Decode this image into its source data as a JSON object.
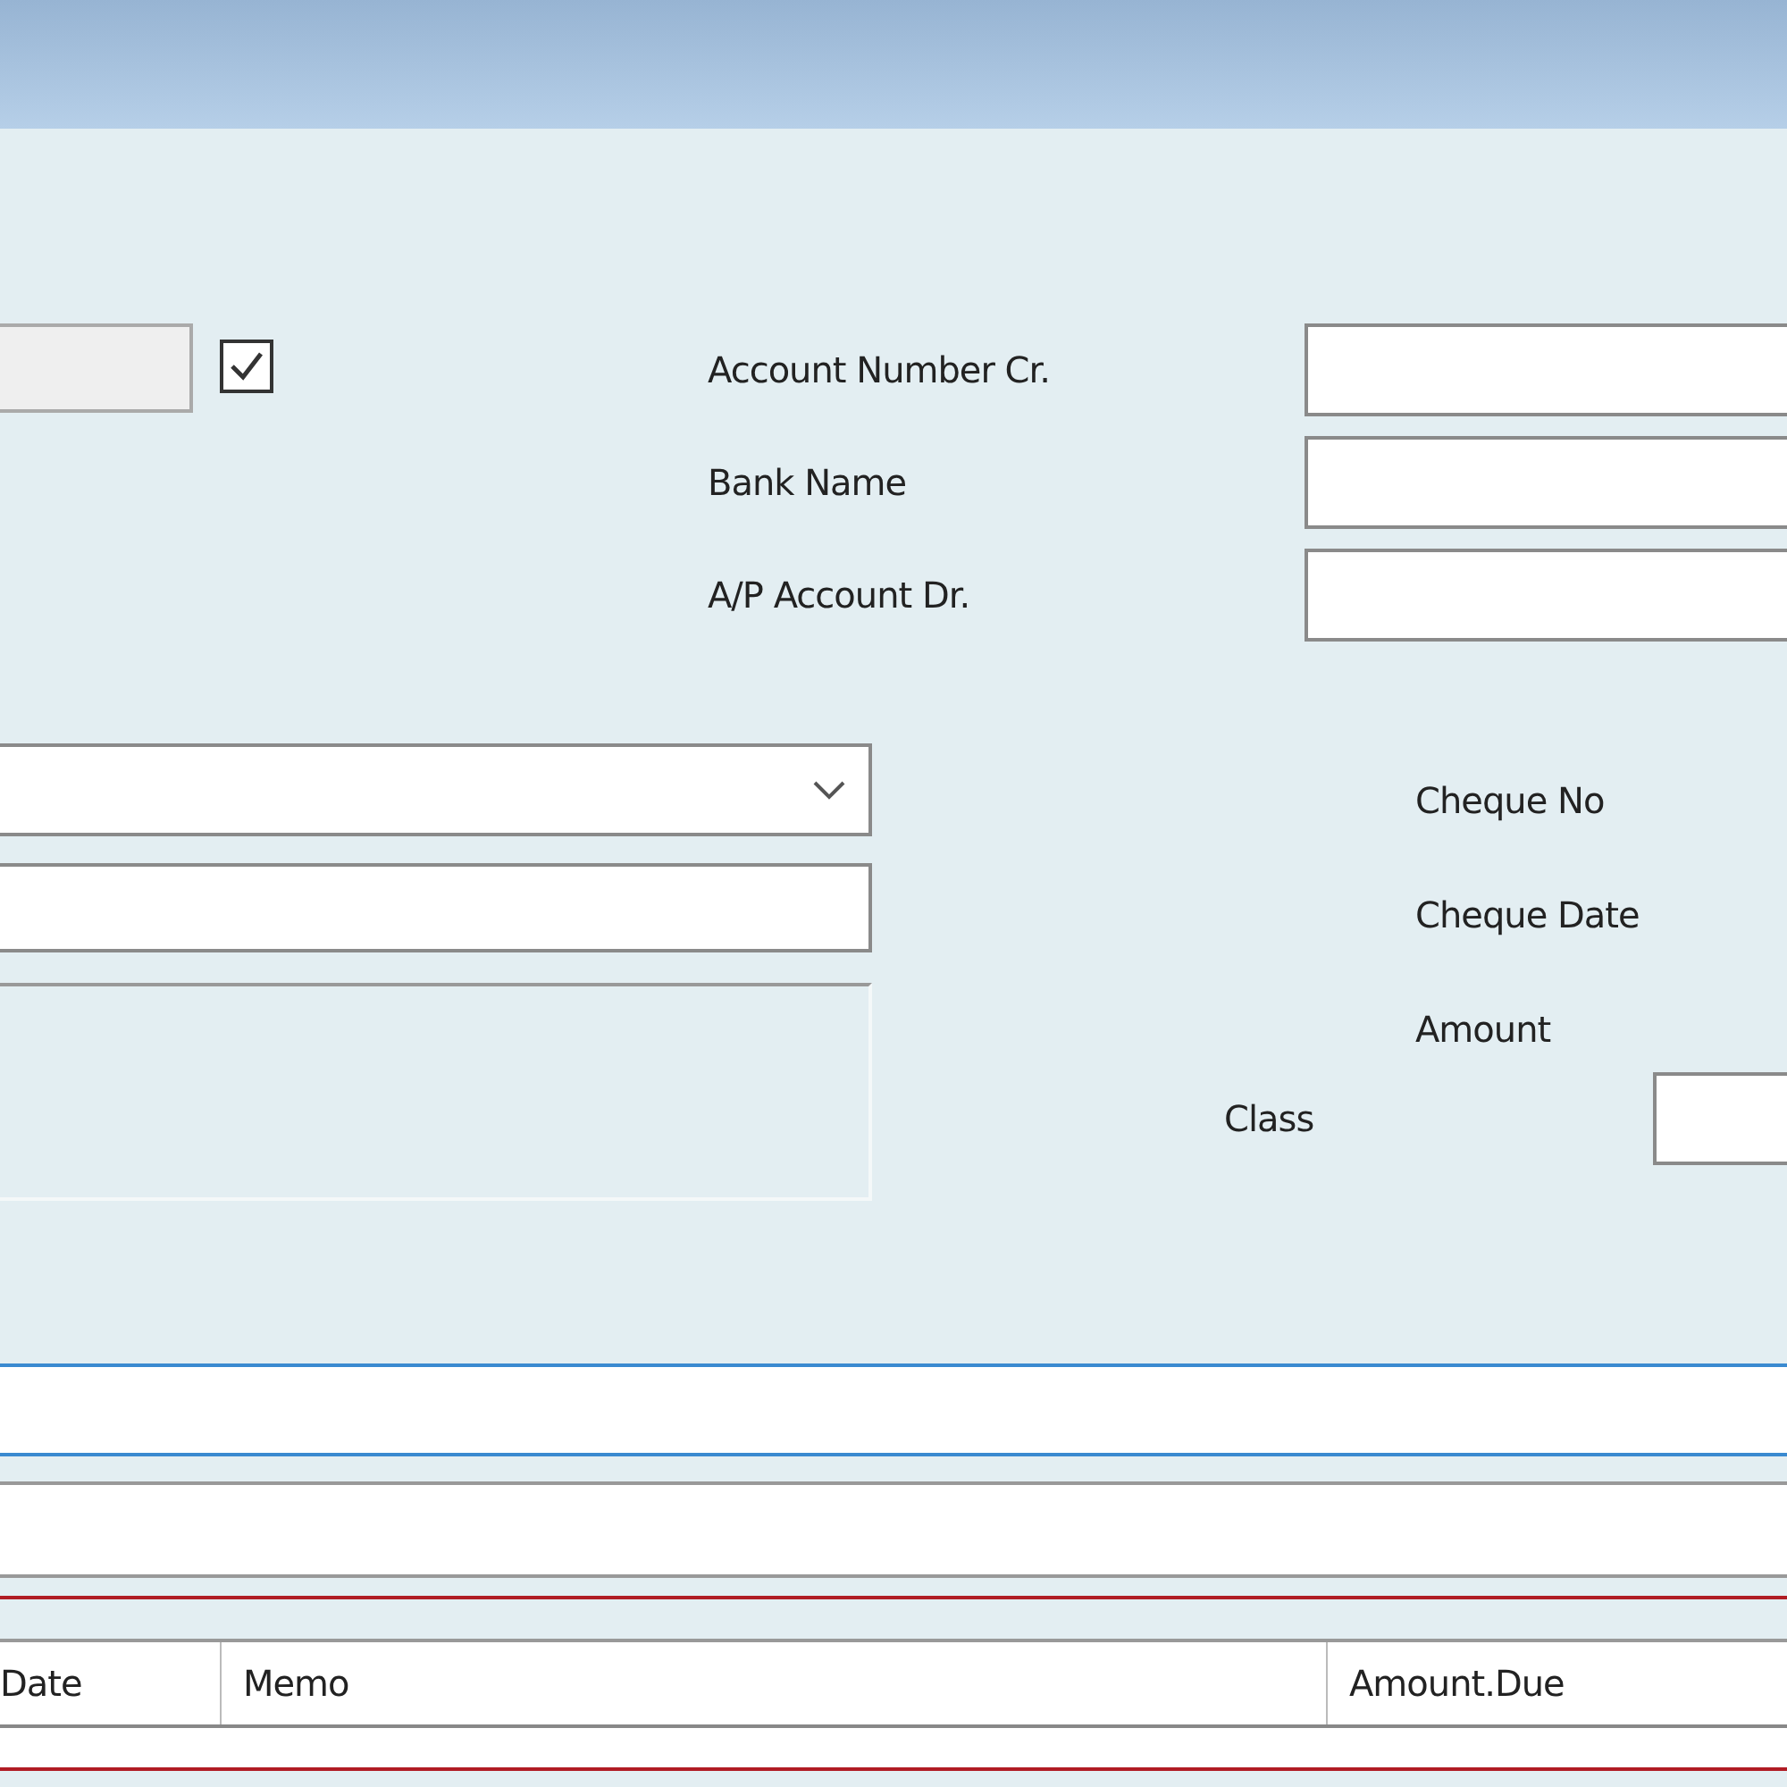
{
  "form": {
    "top_field": {
      "disabled": true
    },
    "checkbox": {
      "checked": true
    },
    "account_fields": [
      {
        "label": "Account Number Cr."
      },
      {
        "label": "Bank Name"
      },
      {
        "label": "A/P Account Dr."
      }
    ],
    "cheque_labels": [
      "Cheque No",
      "Cheque Date",
      "Amount"
    ],
    "class_label": "Class"
  },
  "table": {
    "columns": [
      "Date",
      "Memo",
      "Amount.Due"
    ]
  }
}
